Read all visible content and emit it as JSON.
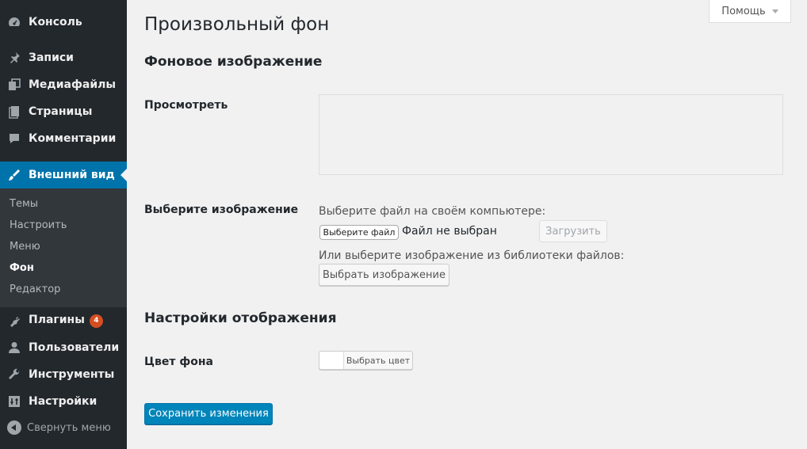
{
  "sidebar": {
    "items": [
      {
        "label": "Консоль",
        "icon": "dashboard-icon"
      },
      {
        "label": "Записи",
        "icon": "pin-icon"
      },
      {
        "label": "Медиафайлы",
        "icon": "media-icon"
      },
      {
        "label": "Страницы",
        "icon": "page-icon"
      },
      {
        "label": "Комментарии",
        "icon": "comment-icon"
      },
      {
        "label": "Внешний вид",
        "icon": "brush-icon"
      },
      {
        "label": "Плагины",
        "icon": "plugin-icon",
        "badge": "4"
      },
      {
        "label": "Пользователи",
        "icon": "user-icon"
      },
      {
        "label": "Инструменты",
        "icon": "wrench-icon"
      },
      {
        "label": "Настройки",
        "icon": "settings-icon"
      }
    ],
    "submenu": [
      "Темы",
      "Настроить",
      "Меню",
      "Фон",
      "Редактор"
    ],
    "collapse_label": "Свернуть меню"
  },
  "help_tab": {
    "label": "Помощь"
  },
  "main": {
    "page_title": "Произвольный фон",
    "section_background": "Фоновое изображение",
    "preview_label": "Просмотреть",
    "select_label": "Выберите изображение",
    "computer_hint": "Выберите файл на своём компьютере:",
    "file_button": "Выберите файл",
    "file_status": "Файл не выбран",
    "upload_button": "Загрузить",
    "library_hint": "Или выберите изображение из библиотеки файлов:",
    "choose_button": "Выбрать изображение",
    "section_display": "Настройки отображения",
    "color_label": "Цвет фона",
    "color_button": "Выбрать цвет",
    "save_button": "Сохранить изменения"
  },
  "colors": {
    "sidebar": "#23282d",
    "submenu": "#32373c",
    "accent": "#0073aa",
    "badge": "#d54e21",
    "primary_button": "#0085ba"
  }
}
